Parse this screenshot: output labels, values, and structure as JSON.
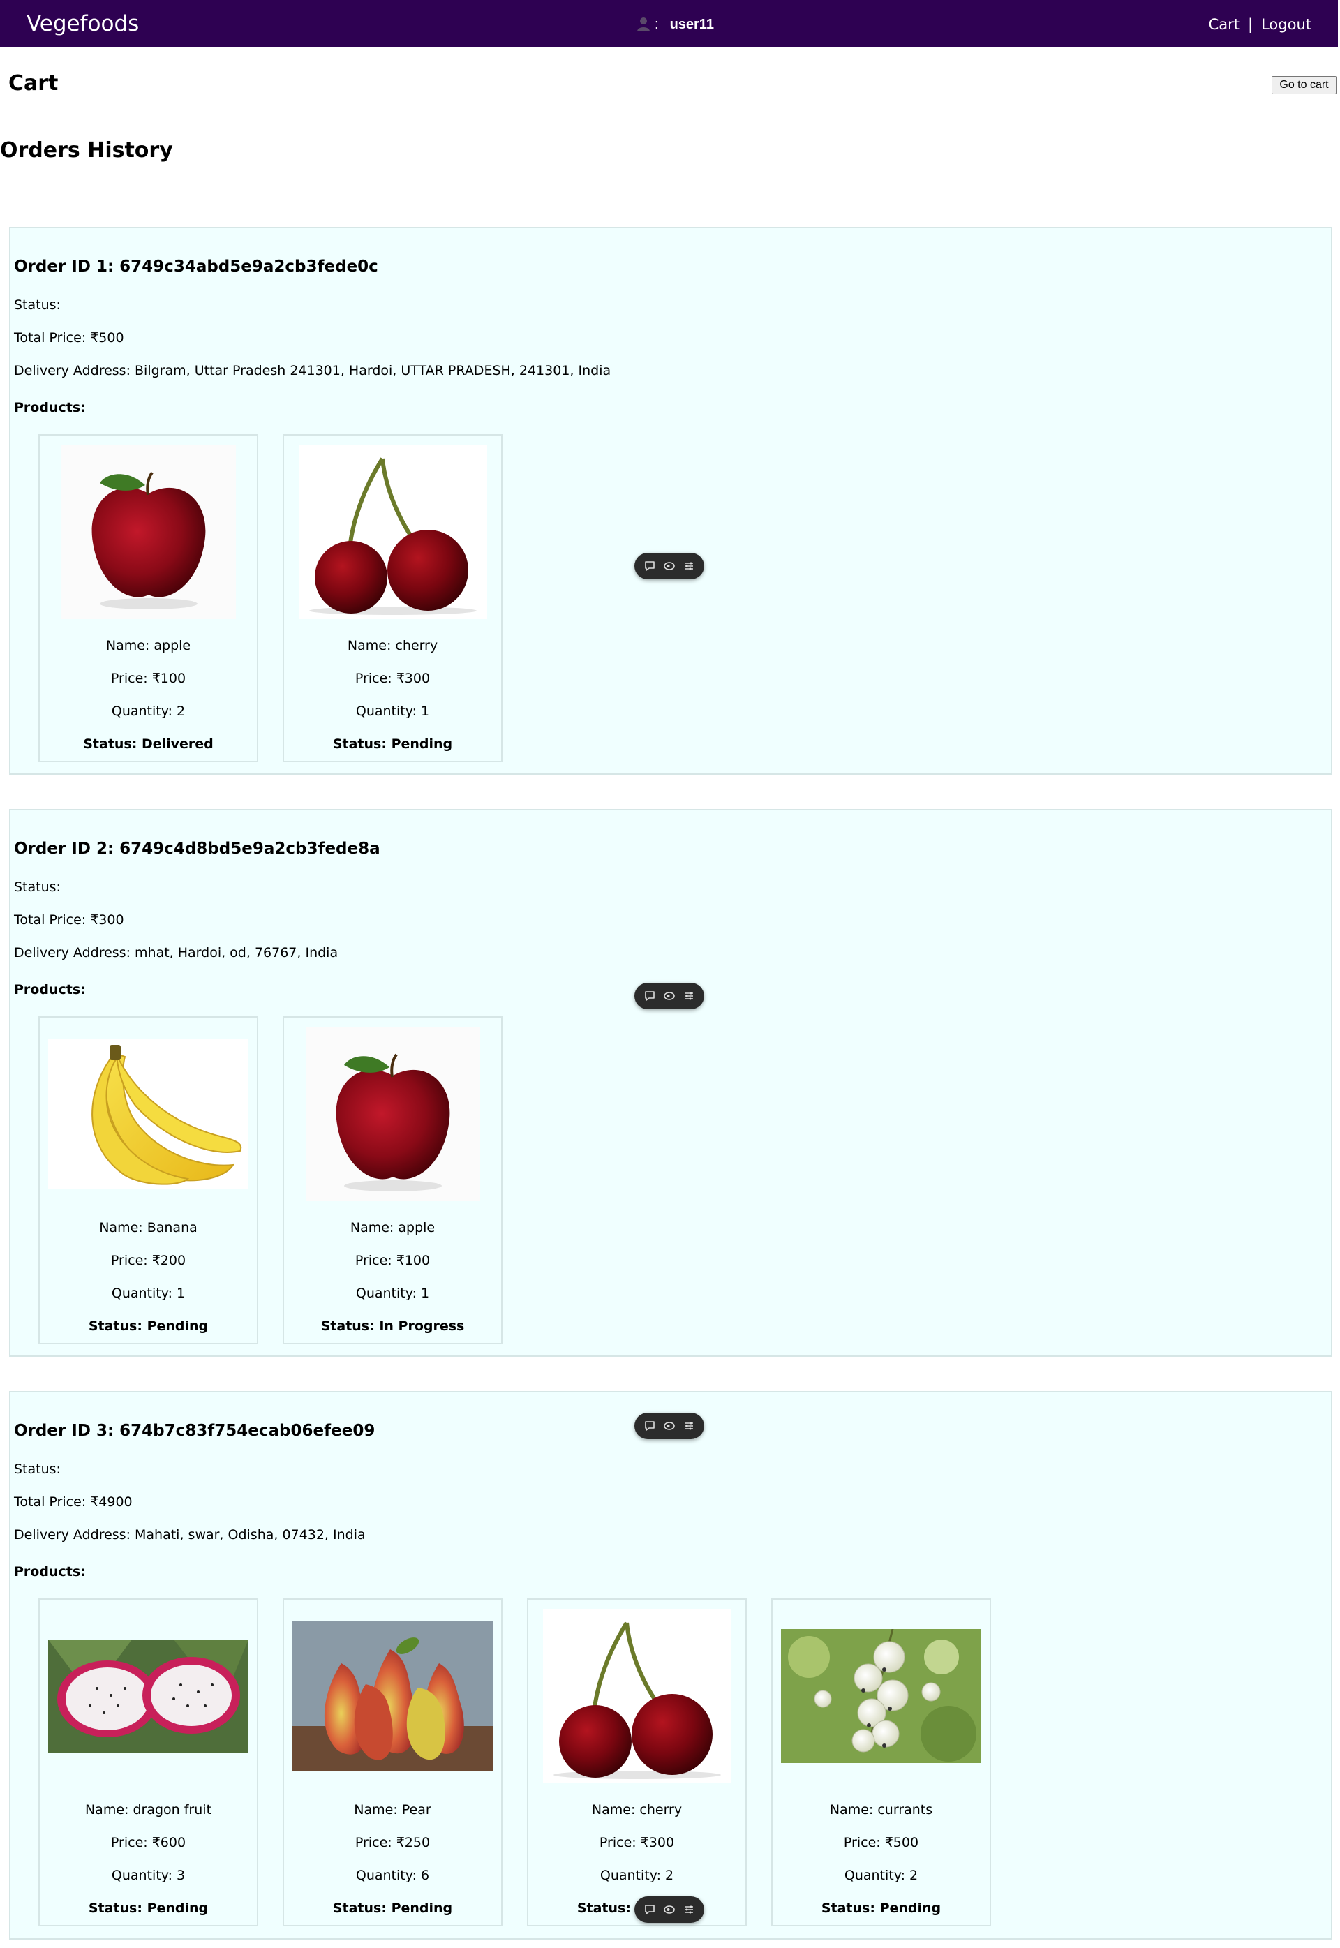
{
  "navbar": {
    "brand": "Vegefoods",
    "user_separator": ":",
    "username": "user11",
    "cart_link": "Cart",
    "divider": "|",
    "logout_link": "Logout"
  },
  "cart_section": {
    "title": "Cart",
    "go_to_cart_button": "Go to cart"
  },
  "history_title": "Orders History",
  "orders": [
    {
      "id_line": "Order ID 1: 6749c34abd5e9a2cb3fede0c",
      "status_line": "Status:",
      "total_line": "Total Price: ₹500",
      "address_line": "Delivery Address: Bilgram, Uttar Pradesh 241301, Hardoi, UTTAR PRADESH, 241301, India",
      "products_label": "Products:",
      "products": [
        {
          "image": "apple-image",
          "name": "Name: apple",
          "price": "Price: ₹100",
          "quantity": "Quantity: 2",
          "status": "Status: Delivered"
        },
        {
          "image": "cherry-image",
          "name": "Name: cherry",
          "price": "Price: ₹300",
          "quantity": "Quantity: 1",
          "status": "Status: Pending"
        }
      ]
    },
    {
      "id_line": "Order ID 2: 6749c4d8bd5e9a2cb3fede8a",
      "status_line": "Status:",
      "total_line": "Total Price: ₹300",
      "address_line": "Delivery Address: mhat, Hardoi, od, 76767, India",
      "products_label": "Products:",
      "products": [
        {
          "image": "banana-image",
          "name": "Name: Banana",
          "price": "Price: ₹200",
          "quantity": "Quantity: 1",
          "status": "Status: Pending"
        },
        {
          "image": "apple-image",
          "name": "Name: apple",
          "price": "Price: ₹100",
          "quantity": "Quantity: 1",
          "status": "Status: In Progress"
        }
      ]
    },
    {
      "id_line": "Order ID 3: 674b7c83f754ecab06efee09",
      "status_line": "Status:",
      "total_line": "Total Price: ₹4900",
      "address_line": "Delivery Address: Mahati, swar, Odisha, 07432, India",
      "products_label": "Products:",
      "products": [
        {
          "image": "dragon-fruit-image",
          "name": "Name: dragon fruit",
          "price": "Price: ₹600",
          "quantity": "Quantity: 3",
          "status": "Status: Pending"
        },
        {
          "image": "pear-image",
          "name": "Name: Pear",
          "price": "Price: ₹250",
          "quantity": "Quantity: 6",
          "status": "Status: Pending"
        },
        {
          "image": "cherry-image",
          "name": "Name: cherry",
          "price": "Price: ₹300",
          "quantity": "Quantity: 2",
          "status": "Status: Pending"
        },
        {
          "image": "currants-image",
          "name": "Name: currants",
          "price": "Price: ₹500",
          "quantity": "Quantity: 2",
          "status": "Status: Pending"
        }
      ]
    }
  ],
  "floating_toolbar": {
    "icons": [
      "comment-icon",
      "eye-icon",
      "settings-icon"
    ]
  },
  "colors": {
    "navbar_bg": "#2e0152",
    "order_bg": "#f0ffff",
    "border": "#d6e6e6",
    "toolbar_bg": "#2b2b2b"
  }
}
